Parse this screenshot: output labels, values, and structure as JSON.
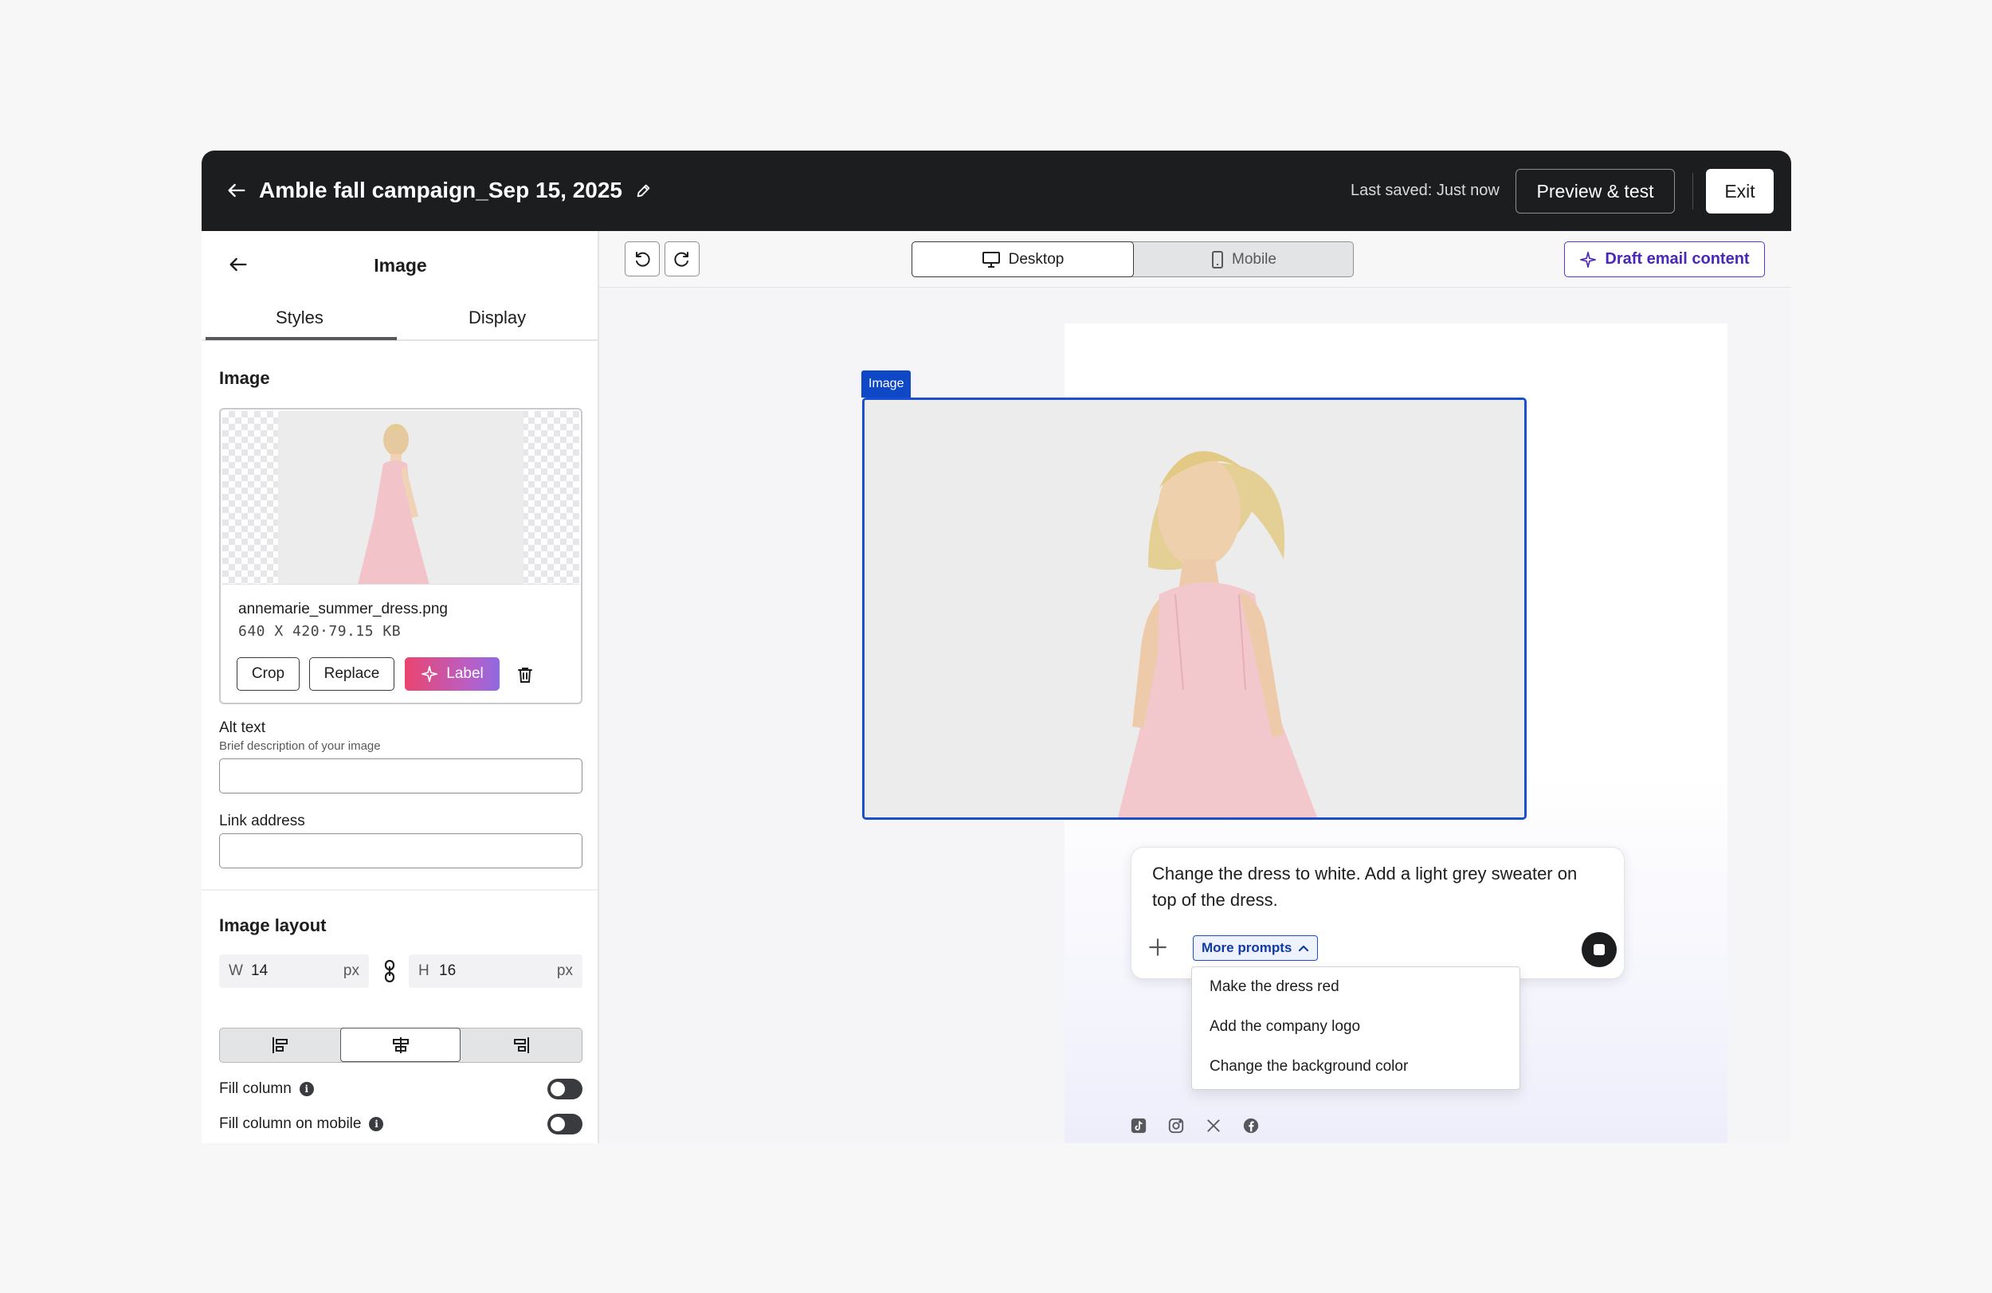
{
  "header": {
    "title": "Amble fall campaign_Sep 15, 2025",
    "last_saved": "Last saved: Just now",
    "preview_label": "Preview & test",
    "exit_label": "Exit"
  },
  "panel": {
    "title": "Image",
    "tabs": [
      {
        "label": "Styles",
        "active": true
      },
      {
        "label": "Display",
        "active": false
      }
    ],
    "image_section_title": "Image",
    "file": {
      "name": "annemarie_summer_dress.png",
      "meta": "640 X 420·79.15 KB"
    },
    "buttons": {
      "crop": "Crop",
      "replace": "Replace",
      "label": "Label"
    },
    "alt_text": {
      "label": "Alt text",
      "help": "Brief description of your image",
      "value": ""
    },
    "link_address": {
      "label": "Link address",
      "value": ""
    },
    "layout": {
      "title": "Image layout",
      "width": {
        "prefix": "W",
        "value": "14",
        "unit": "px"
      },
      "height": {
        "prefix": "H",
        "value": "16",
        "unit": "px"
      },
      "alignment_selected": "center",
      "fill_column": {
        "label": "Fill column",
        "on": false
      },
      "fill_column_mobile": {
        "label": "Fill column on mobile",
        "on": false
      }
    }
  },
  "toolbar": {
    "view_desktop": "Desktop",
    "view_mobile": "Mobile",
    "active_view": "Desktop",
    "draft_label": "Draft email content"
  },
  "canvas": {
    "selected_tag": "Image",
    "prompt_text": "Change the dress to white. Add a light grey sweater on top of the dress.",
    "more_prompts_label": "More prompts",
    "more_prompts": [
      "Make the dress red",
      "Add the company logo",
      "Change the background color"
    ],
    "social_icons": [
      "tiktok-icon",
      "instagram-icon",
      "x-icon",
      "facebook-icon"
    ]
  },
  "colors": {
    "topbar_bg": "#1c1d1f",
    "selection_blue": "#1b4fd0",
    "ai_gradient_start": "#e9456f",
    "ai_gradient_end": "#8e6adf",
    "draft_purple": "#5b32d6"
  }
}
